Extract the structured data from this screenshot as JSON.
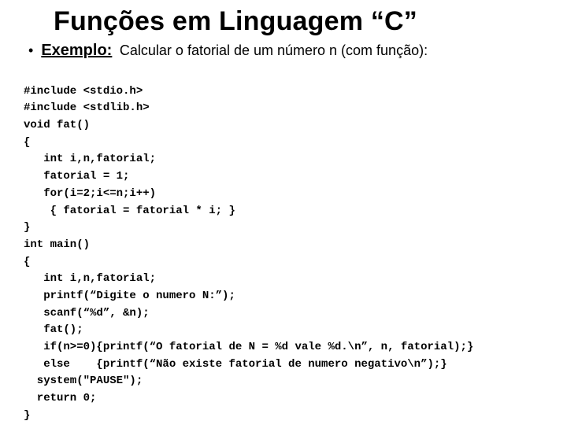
{
  "title": "Funções em Linguagem “C”",
  "bullet": {
    "dot": "•",
    "label": "Exemplo:",
    "text": "Calcular o fatorial de um número n (com função):"
  },
  "code": {
    "l01": "#include <stdio.h>",
    "l02": "#include <stdlib.h>",
    "l03": "void fat()",
    "l04": "{",
    "l05": "   int i,n,fatorial;",
    "l06": "   fatorial = 1;",
    "l07": "   for(i=2;i<=n;i++)",
    "l08": "    { fatorial = fatorial * i; }",
    "l09": "}",
    "l10": "int main()",
    "l11": "{",
    "l12": "   int i,n,fatorial;",
    "l13": "   printf(“Digite o numero N:”);",
    "l14": "   scanf(“%d”, &n);",
    "l15": "   fat();",
    "l16": "   if(n>=0){printf(“O fatorial de N = %d vale %d.\\n”, n, fatorial);}",
    "l17": "   else    {printf(“Não existe fatorial de numero negativo\\n”);}",
    "l18": "  system(\"PAUSE\");",
    "l19": "  return 0;",
    "l20": "}"
  }
}
